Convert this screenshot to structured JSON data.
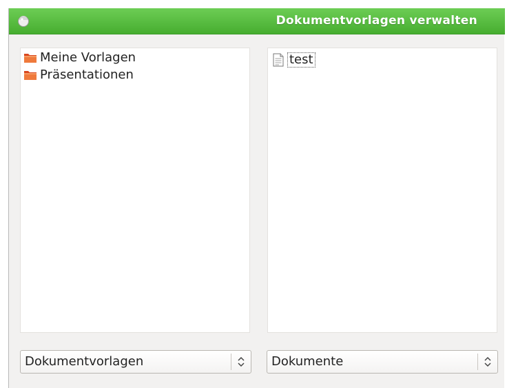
{
  "window": {
    "title": "Dokumentvorlagen verwalten",
    "titlebar_color": "#52b83a"
  },
  "left_pane": {
    "items": [
      {
        "label": "Meine Vorlagen",
        "icon": "folder-icon"
      },
      {
        "label": "Präsentationen",
        "icon": "folder-icon"
      }
    ]
  },
  "right_pane": {
    "items": [
      {
        "label": "test",
        "icon": "document-icon",
        "focused": true
      }
    ]
  },
  "left_combo": {
    "selected": "Dokumentvorlagen"
  },
  "right_combo": {
    "selected": "Dokumente"
  }
}
